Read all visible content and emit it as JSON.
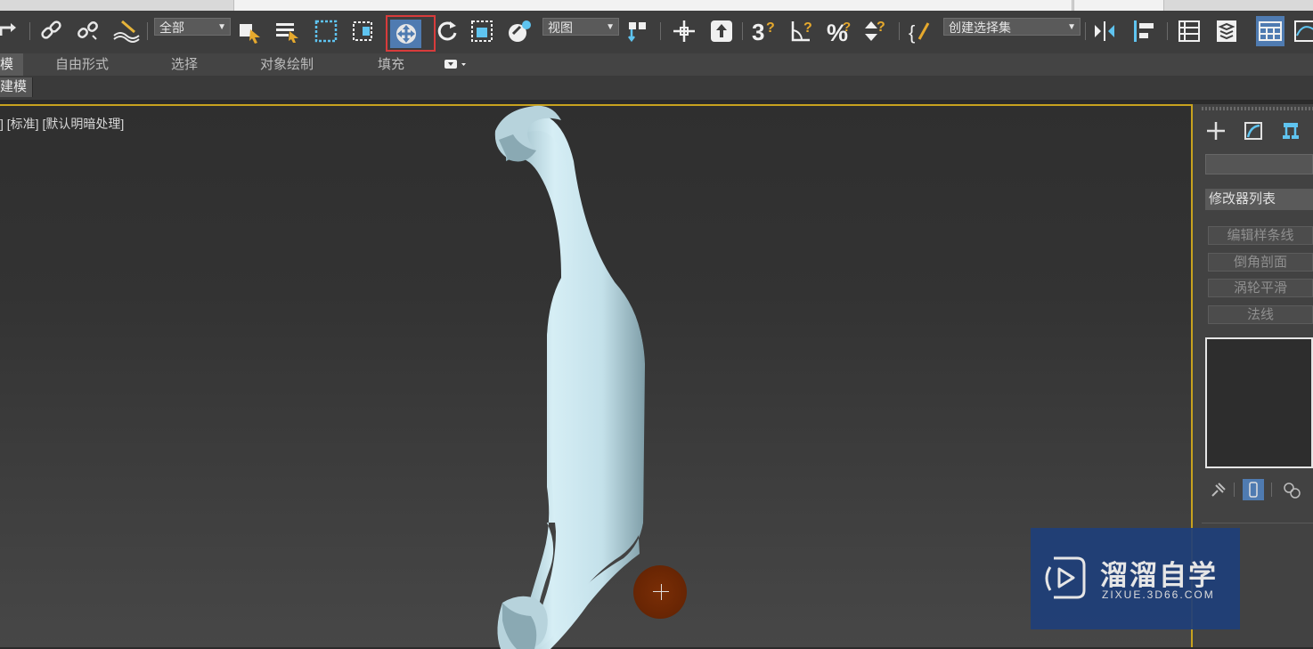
{
  "toolbar": {
    "selection_filter": "全部",
    "reference_coord": "视图",
    "named_selection_set": "创建选择集"
  },
  "ribbon": {
    "tabs": [
      "模",
      "自由形式",
      "选择",
      "对象绘制",
      "填充"
    ],
    "sub_label": "建模"
  },
  "viewport": {
    "label": "] [标准] [默认明暗处理]"
  },
  "command_panel": {
    "modifier_list": "修改器列表",
    "buttons": [
      "编辑样条线",
      "倒角剖面",
      "涡轮平滑",
      "法线"
    ]
  },
  "watermark": {
    "brand": "溜溜自学",
    "url": "ZIXUE.3D66.COM"
  },
  "colors": {
    "accent_active": "#4f7bb1",
    "highlight_border": "#d83b3b",
    "viewport_border": "#c8a21e",
    "model": "#c7e3ec"
  }
}
